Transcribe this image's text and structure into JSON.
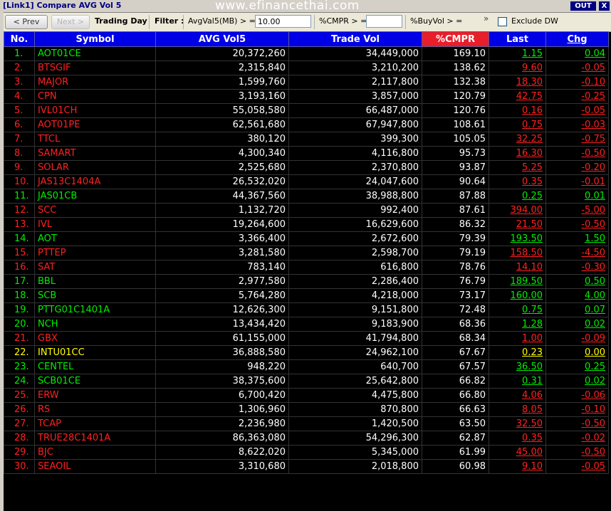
{
  "window": {
    "title": "[Link1] Compare AVG Vol 5",
    "watermark": "www.efinancethai.com",
    "out_label": "OUT",
    "close_label": "X"
  },
  "toolbar": {
    "prev_label": "< Prev",
    "next_label": "Next >",
    "trading_day_label": "Trading Day",
    "filter_label": "Filter :",
    "avgvol_label": "AvgVal5(MB) > =",
    "avgvol_value": "10.00",
    "cmpr_label": "%CMPR > =",
    "cmpr_value": "",
    "buyvol_label": "%BuyVol > =",
    "more_label": "»",
    "exclude_dw_label": "Exclude DW"
  },
  "table": {
    "headers": [
      "No.",
      "Symbol",
      "AVG Vol5",
      "Trade Vol",
      "%CMPR",
      "Last",
      "Chg"
    ],
    "rows": [
      {
        "no": "1.",
        "symbol": "AOT01CE",
        "avg": "20,372,260",
        "vol": "34,449,000",
        "cmpr": "169.10",
        "last": "1.15",
        "chg": "0.04",
        "color": "#00ee00"
      },
      {
        "no": "2.",
        "symbol": "BTSGIF",
        "avg": "2,315,840",
        "vol": "3,210,200",
        "cmpr": "138.62",
        "last": "9.60",
        "chg": "-0.05",
        "color": "#ff2020"
      },
      {
        "no": "3.",
        "symbol": "MAJOR",
        "avg": "1,599,760",
        "vol": "2,117,800",
        "cmpr": "132.38",
        "last": "18.30",
        "chg": "-0.10",
        "color": "#ff2020"
      },
      {
        "no": "4.",
        "symbol": "CPN",
        "avg": "3,193,160",
        "vol": "3,857,000",
        "cmpr": "120.79",
        "last": "42.75",
        "chg": "-0.25",
        "color": "#ff2020"
      },
      {
        "no": "5.",
        "symbol": "IVL01CH",
        "avg": "55,058,580",
        "vol": "66,487,000",
        "cmpr": "120.76",
        "last": "0.16",
        "chg": "-0.05",
        "color": "#ff2020"
      },
      {
        "no": "6.",
        "symbol": "AOT01PE",
        "avg": "62,561,680",
        "vol": "67,947,800",
        "cmpr": "108.61",
        "last": "0.75",
        "chg": "-0.03",
        "color": "#ff2020"
      },
      {
        "no": "7.",
        "symbol": "TTCL",
        "avg": "380,120",
        "vol": "399,300",
        "cmpr": "105.05",
        "last": "32.25",
        "chg": "-0.75",
        "color": "#ff2020"
      },
      {
        "no": "8.",
        "symbol": "SAMART",
        "avg": "4,300,340",
        "vol": "4,116,800",
        "cmpr": "95.73",
        "last": "16.30",
        "chg": "-0.50",
        "color": "#ff2020"
      },
      {
        "no": "9.",
        "symbol": "SOLAR",
        "avg": "2,525,680",
        "vol": "2,370,800",
        "cmpr": "93.87",
        "last": "5.25",
        "chg": "-0.20",
        "color": "#ff2020"
      },
      {
        "no": "10.",
        "symbol": "JAS13C1404A",
        "avg": "26,532,020",
        "vol": "24,047,600",
        "cmpr": "90.64",
        "last": "0.35",
        "chg": "-0.01",
        "color": "#ff2020"
      },
      {
        "no": "11.",
        "symbol": "JAS01CB",
        "avg": "44,367,560",
        "vol": "38,988,800",
        "cmpr": "87.88",
        "last": "0.25",
        "chg": "0.01",
        "color": "#00ee00"
      },
      {
        "no": "12.",
        "symbol": "SCC",
        "avg": "1,132,720",
        "vol": "992,400",
        "cmpr": "87.61",
        "last": "394.00",
        "chg": "-5.00",
        "color": "#ff2020"
      },
      {
        "no": "13.",
        "symbol": "IVL",
        "avg": "19,264,600",
        "vol": "16,629,600",
        "cmpr": "86.32",
        "last": "21.50",
        "chg": "-0.50",
        "color": "#ff2020"
      },
      {
        "no": "14.",
        "symbol": "AOT",
        "avg": "3,366,400",
        "vol": "2,672,600",
        "cmpr": "79.39",
        "last": "193.50",
        "chg": "1.50",
        "color": "#00ee00"
      },
      {
        "no": "15.",
        "symbol": "PTTEP",
        "avg": "3,281,580",
        "vol": "2,598,700",
        "cmpr": "79.19",
        "last": "158.50",
        "chg": "-4.50",
        "color": "#ff2020"
      },
      {
        "no": "16.",
        "symbol": "SAT",
        "avg": "783,140",
        "vol": "616,800",
        "cmpr": "78.76",
        "last": "14.10",
        "chg": "-0.30",
        "color": "#ff2020"
      },
      {
        "no": "17.",
        "symbol": "BBL",
        "avg": "2,977,580",
        "vol": "2,286,400",
        "cmpr": "76.79",
        "last": "189.50",
        "chg": "0.50",
        "color": "#00ee00"
      },
      {
        "no": "18.",
        "symbol": "SCB",
        "avg": "5,764,280",
        "vol": "4,218,000",
        "cmpr": "73.17",
        "last": "160.00",
        "chg": "4.00",
        "color": "#00ee00"
      },
      {
        "no": "19.",
        "symbol": "PTTG01C1401A",
        "avg": "12,626,300",
        "vol": "9,151,800",
        "cmpr": "72.48",
        "last": "0.75",
        "chg": "0.07",
        "color": "#00ee00"
      },
      {
        "no": "20.",
        "symbol": "NCH",
        "avg": "13,434,420",
        "vol": "9,183,900",
        "cmpr": "68.36",
        "last": "1.28",
        "chg": "0.02",
        "color": "#00ee00"
      },
      {
        "no": "21.",
        "symbol": "GBX",
        "avg": "61,155,000",
        "vol": "41,794,800",
        "cmpr": "68.34",
        "last": "1.00",
        "chg": "-0.09",
        "color": "#ff2020"
      },
      {
        "no": "22.",
        "symbol": "INTU01CC",
        "avg": "36,888,580",
        "vol": "24,962,100",
        "cmpr": "67.67",
        "last": "0.23",
        "chg": "0.00",
        "color": "#ffff00"
      },
      {
        "no": "23.",
        "symbol": "CENTEL",
        "avg": "948,220",
        "vol": "640,700",
        "cmpr": "67.57",
        "last": "36.50",
        "chg": "0.25",
        "color": "#00ee00"
      },
      {
        "no": "24.",
        "symbol": "SCB01CE",
        "avg": "38,375,600",
        "vol": "25,642,800",
        "cmpr": "66.82",
        "last": "0.31",
        "chg": "0.02",
        "color": "#00ee00"
      },
      {
        "no": "25.",
        "symbol": "ERW",
        "avg": "6,700,420",
        "vol": "4,475,800",
        "cmpr": "66.80",
        "last": "4.06",
        "chg": "-0.06",
        "color": "#ff2020"
      },
      {
        "no": "26.",
        "symbol": "RS",
        "avg": "1,306,960",
        "vol": "870,800",
        "cmpr": "66.63",
        "last": "8.05",
        "chg": "-0.10",
        "color": "#ff2020"
      },
      {
        "no": "27.",
        "symbol": "TCAP",
        "avg": "2,236,980",
        "vol": "1,420,500",
        "cmpr": "63.50",
        "last": "32.50",
        "chg": "-0.50",
        "color": "#ff2020"
      },
      {
        "no": "28.",
        "symbol": "TRUE28C1401A",
        "avg": "86,363,080",
        "vol": "54,296,300",
        "cmpr": "62.87",
        "last": "0.35",
        "chg": "-0.02",
        "color": "#ff2020"
      },
      {
        "no": "29.",
        "symbol": "BJC",
        "avg": "8,622,020",
        "vol": "5,345,000",
        "cmpr": "61.99",
        "last": "45.00",
        "chg": "-0.50",
        "color": "#ff2020"
      },
      {
        "no": "30.",
        "symbol": "SEAOIL",
        "avg": "3,310,680",
        "vol": "2,018,800",
        "cmpr": "60.98",
        "last": "9.10",
        "chg": "-0.05",
        "color": "#ff2020"
      }
    ]
  },
  "colors": {
    "header_bg": "#0000e6",
    "header_sort_bg": "#e81e2a",
    "up": "#00ee00",
    "down": "#ff2020",
    "unchanged": "#ffff00",
    "background": "#000000"
  }
}
